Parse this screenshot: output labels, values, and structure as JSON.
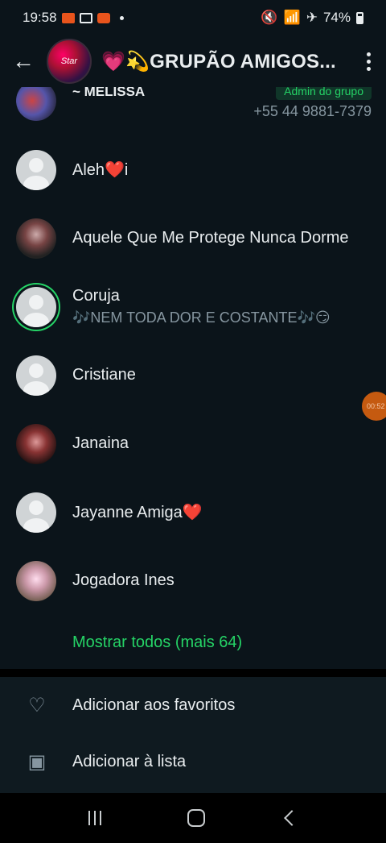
{
  "status_bar": {
    "time": "19:58",
    "battery": "74%"
  },
  "header": {
    "title": "💗💫GRUPÃO AMIGOS...",
    "group_avatar_text": "Star"
  },
  "members": [
    {
      "name": "~ MELISSA",
      "badge": "Admin do grupo",
      "phone": "+55 44 9881-7379"
    },
    {
      "name": "Aleh❤️i"
    },
    {
      "name": "Aquele Que Me Protege Nunca Dorme"
    },
    {
      "name": "Coruja",
      "status": "🎶NEM TODA DOR E COSTANTE🎶😏"
    },
    {
      "name": "Cristiane"
    },
    {
      "name": "Janaina"
    },
    {
      "name": "Jayanne Amiga❤️"
    },
    {
      "name": "Jogadora Ines"
    }
  ],
  "show_all": "Mostrar todos (mais 64)",
  "actions": {
    "favorites": "Adicionar aos favoritos",
    "list": "Adicionar à lista"
  },
  "floating_timer": "00:52"
}
